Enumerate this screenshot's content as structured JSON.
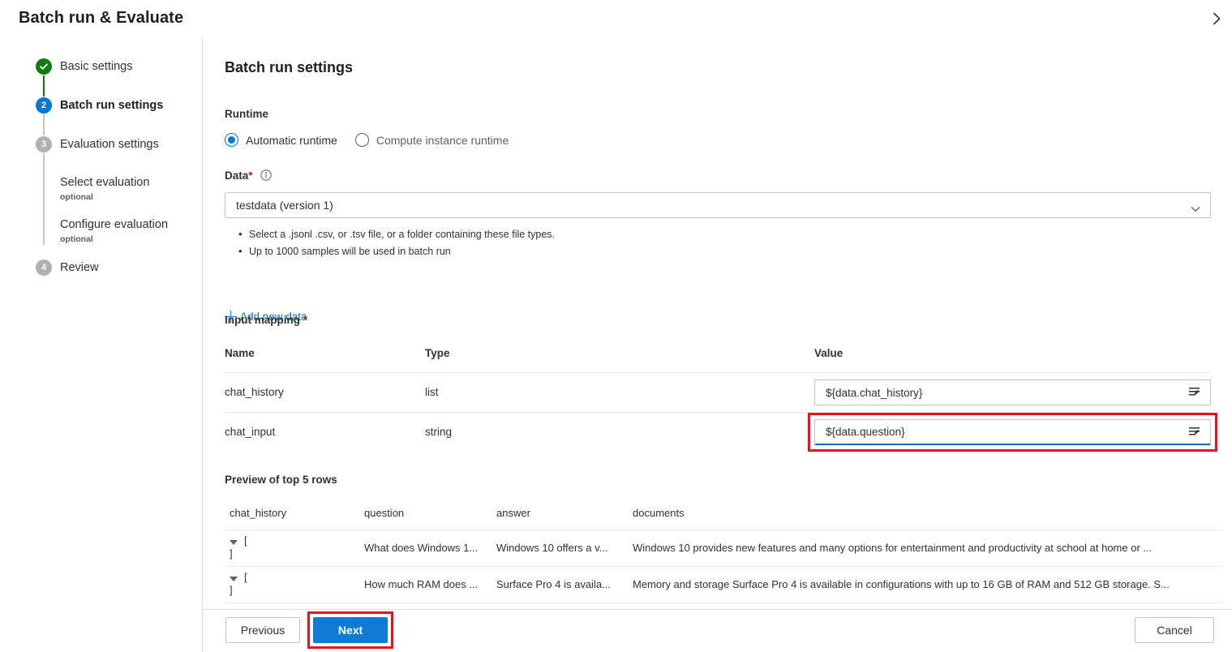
{
  "header": {
    "title": "Batch run & Evaluate",
    "collapse_icon": "chevron-right-icon"
  },
  "wizard": {
    "steps": [
      {
        "num": "",
        "label": "Basic settings",
        "state": "done"
      },
      {
        "num": "2",
        "label": "Batch run settings",
        "state": "current"
      },
      {
        "num": "3",
        "label": "Evaluation settings",
        "state": "pending"
      },
      {
        "num": "4",
        "label": "Review",
        "state": "pending"
      }
    ],
    "substeps": [
      {
        "label": "Select evaluation",
        "note": "optional"
      },
      {
        "label": "Configure evaluation",
        "note": "optional"
      }
    ]
  },
  "main": {
    "section_title": "Batch run settings",
    "runtime": {
      "label": "Runtime",
      "options": [
        {
          "label": "Automatic runtime",
          "selected": true
        },
        {
          "label": "Compute instance runtime",
          "selected": false
        }
      ]
    },
    "data": {
      "label": "Data",
      "required_mark": "*",
      "info_icon": "info-icon",
      "selected_value": "testdata (version 1)",
      "chevron_icon": "chevron-down-icon",
      "hints": [
        "Select a .jsonl .csv, or .tsv file, or a folder containing these file types.",
        "Up to 1000 samples will be used in batch run"
      ],
      "add_link": "Add new data",
      "add_icon": "plus-icon"
    },
    "input_mapping": {
      "label": "Input mapping",
      "required_mark": "*",
      "columns": [
        "Name",
        "Type",
        "Value"
      ],
      "rows": [
        {
          "name": "chat_history",
          "type": "list",
          "value": "${data.chat_history}",
          "icon": "edit-lines-icon",
          "focused": false,
          "highlighted": false
        },
        {
          "name": "chat_input",
          "type": "string",
          "value": "${data.question}",
          "icon": "edit-lines-icon",
          "focused": true,
          "highlighted": true
        }
      ]
    },
    "preview": {
      "title": "Preview of top 5 rows",
      "columns": [
        "chat_history",
        "question",
        "answer",
        "documents"
      ],
      "rows": [
        {
          "chat_history_open": "[",
          "chat_history_close": "]",
          "question": "What does Windows 1...",
          "answer": "Windows 10 offers a v...",
          "documents": "Windows 10 provides new features and many options for entertainment and productivity at school at home or ..."
        },
        {
          "chat_history_open": "[",
          "chat_history_close": "]",
          "question": "How much RAM does ...",
          "answer": "Surface Pro 4 is availa...",
          "documents": "Memory and storage Surface Pro 4 is available in configurations with up to 16 GB of RAM and 512 GB storage. S..."
        }
      ]
    }
  },
  "footer": {
    "previous": "Previous",
    "next": "Next",
    "cancel": "Cancel"
  },
  "colors": {
    "accent": "#0078d4",
    "primary_button": "#0f7bd4",
    "link": "#0f6cbd",
    "success": "#107c10",
    "pending": "#b3b0ad",
    "required": "#a4262c",
    "highlight": "#e81123"
  }
}
